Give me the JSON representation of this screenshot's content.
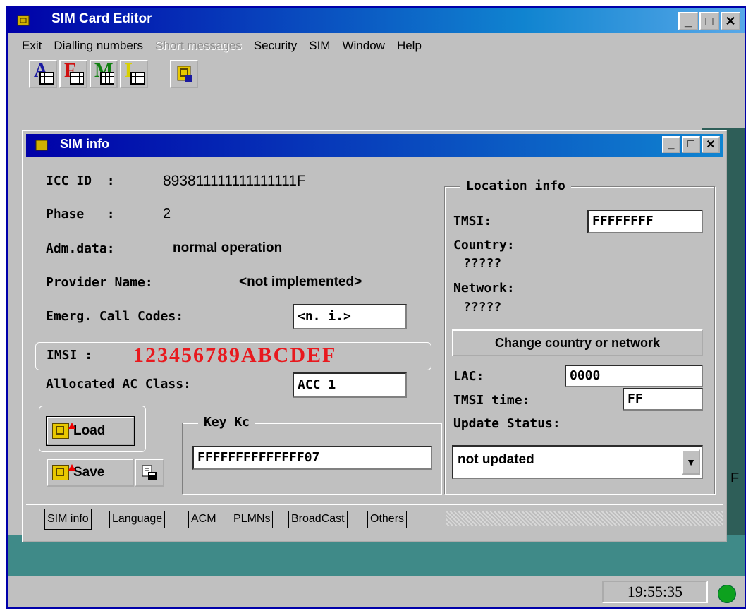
{
  "app": {
    "title": "SIM Card Editor"
  },
  "menu": [
    "Exit",
    "Dialling numbers",
    "Short messages",
    "Security",
    "SIM",
    "Window",
    "Help"
  ],
  "toolbar": {
    "buttons": [
      {
        "letter": "A",
        "color": "#1a1aa0"
      },
      {
        "letter": "F",
        "color": "#d01010"
      },
      {
        "letter": "M",
        "color": "#108010"
      },
      {
        "letter": "L",
        "color": "#d8d000"
      }
    ]
  },
  "window_buttons": {
    "minimize": "_",
    "maximize": "□",
    "close": "✕"
  },
  "child": {
    "title": "SIM info",
    "icc_label": "ICC ID  :",
    "icc_value": "893811111111111111F",
    "phase_label": "Phase   :",
    "phase_value": "2",
    "adm_label": "Adm.data:",
    "adm_value": "normal operation",
    "provider_label": "Provider Name:",
    "provider_value": "<not implemented>",
    "emerg_label": "Emerg. Call Codes:",
    "emerg_value": "<n. i.>",
    "imsi_label": "IMSI :",
    "imsi_value": "123456789ABCDEF",
    "acc_label": "Allocated AC Class:",
    "acc_value": "ACC 1",
    "load_label": "Load",
    "save_label": "Save",
    "keykc_title": "Key Kc",
    "keykc_value": "FFFFFFFFFFFFFF07",
    "location": {
      "title": "Location info",
      "tmsi_label": "TMSI:",
      "tmsi_value": "FFFFFFFF",
      "country_label": "Country:",
      "country_value": "?????",
      "network_label": "Network:",
      "network_value": "?????",
      "change_button": "Change country or network",
      "lac_label": "LAC:",
      "lac_value": "0000",
      "tmsi_time_label": "TMSI time:",
      "tmsi_time_value": "FF",
      "update_label": "Update Status:",
      "update_value": "not updated"
    },
    "side_mark": "F",
    "tabs": [
      "SIM info",
      "Language",
      "ACM",
      "PLMNs",
      "BroadCast",
      "Others"
    ]
  },
  "status": {
    "clock": "19:55:35"
  }
}
